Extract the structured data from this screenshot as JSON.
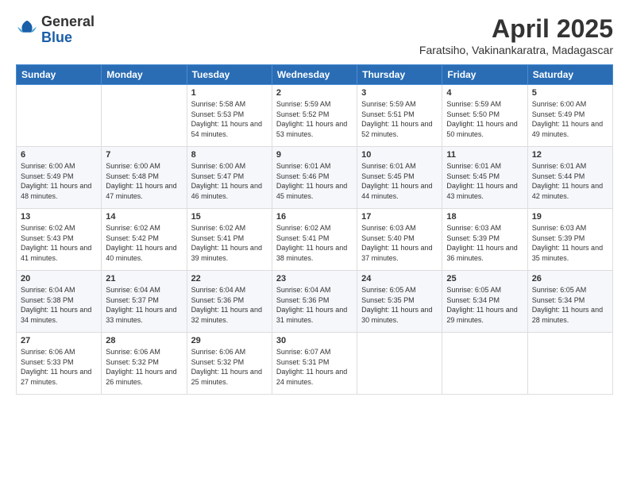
{
  "header": {
    "logo": {
      "general": "General",
      "blue": "Blue"
    },
    "title": "April 2025",
    "location": "Faratsiho, Vakinankaratra, Madagascar"
  },
  "calendar": {
    "days_of_week": [
      "Sunday",
      "Monday",
      "Tuesday",
      "Wednesday",
      "Thursday",
      "Friday",
      "Saturday"
    ],
    "weeks": [
      [
        {
          "day": "",
          "sunrise": "",
          "sunset": "",
          "daylight": "",
          "empty": true
        },
        {
          "day": "",
          "sunrise": "",
          "sunset": "",
          "daylight": "",
          "empty": true
        },
        {
          "day": "1",
          "sunrise": "Sunrise: 5:58 AM",
          "sunset": "Sunset: 5:53 PM",
          "daylight": "Daylight: 11 hours and 54 minutes."
        },
        {
          "day": "2",
          "sunrise": "Sunrise: 5:59 AM",
          "sunset": "Sunset: 5:52 PM",
          "daylight": "Daylight: 11 hours and 53 minutes."
        },
        {
          "day": "3",
          "sunrise": "Sunrise: 5:59 AM",
          "sunset": "Sunset: 5:51 PM",
          "daylight": "Daylight: 11 hours and 52 minutes."
        },
        {
          "day": "4",
          "sunrise": "Sunrise: 5:59 AM",
          "sunset": "Sunset: 5:50 PM",
          "daylight": "Daylight: 11 hours and 50 minutes."
        },
        {
          "day": "5",
          "sunrise": "Sunrise: 6:00 AM",
          "sunset": "Sunset: 5:49 PM",
          "daylight": "Daylight: 11 hours and 49 minutes."
        }
      ],
      [
        {
          "day": "6",
          "sunrise": "Sunrise: 6:00 AM",
          "sunset": "Sunset: 5:49 PM",
          "daylight": "Daylight: 11 hours and 48 minutes."
        },
        {
          "day": "7",
          "sunrise": "Sunrise: 6:00 AM",
          "sunset": "Sunset: 5:48 PM",
          "daylight": "Daylight: 11 hours and 47 minutes."
        },
        {
          "day": "8",
          "sunrise": "Sunrise: 6:00 AM",
          "sunset": "Sunset: 5:47 PM",
          "daylight": "Daylight: 11 hours and 46 minutes."
        },
        {
          "day": "9",
          "sunrise": "Sunrise: 6:01 AM",
          "sunset": "Sunset: 5:46 PM",
          "daylight": "Daylight: 11 hours and 45 minutes."
        },
        {
          "day": "10",
          "sunrise": "Sunrise: 6:01 AM",
          "sunset": "Sunset: 5:45 PM",
          "daylight": "Daylight: 11 hours and 44 minutes."
        },
        {
          "day": "11",
          "sunrise": "Sunrise: 6:01 AM",
          "sunset": "Sunset: 5:45 PM",
          "daylight": "Daylight: 11 hours and 43 minutes."
        },
        {
          "day": "12",
          "sunrise": "Sunrise: 6:01 AM",
          "sunset": "Sunset: 5:44 PM",
          "daylight": "Daylight: 11 hours and 42 minutes."
        }
      ],
      [
        {
          "day": "13",
          "sunrise": "Sunrise: 6:02 AM",
          "sunset": "Sunset: 5:43 PM",
          "daylight": "Daylight: 11 hours and 41 minutes."
        },
        {
          "day": "14",
          "sunrise": "Sunrise: 6:02 AM",
          "sunset": "Sunset: 5:42 PM",
          "daylight": "Daylight: 11 hours and 40 minutes."
        },
        {
          "day": "15",
          "sunrise": "Sunrise: 6:02 AM",
          "sunset": "Sunset: 5:41 PM",
          "daylight": "Daylight: 11 hours and 39 minutes."
        },
        {
          "day": "16",
          "sunrise": "Sunrise: 6:02 AM",
          "sunset": "Sunset: 5:41 PM",
          "daylight": "Daylight: 11 hours and 38 minutes."
        },
        {
          "day": "17",
          "sunrise": "Sunrise: 6:03 AM",
          "sunset": "Sunset: 5:40 PM",
          "daylight": "Daylight: 11 hours and 37 minutes."
        },
        {
          "day": "18",
          "sunrise": "Sunrise: 6:03 AM",
          "sunset": "Sunset: 5:39 PM",
          "daylight": "Daylight: 11 hours and 36 minutes."
        },
        {
          "day": "19",
          "sunrise": "Sunrise: 6:03 AM",
          "sunset": "Sunset: 5:39 PM",
          "daylight": "Daylight: 11 hours and 35 minutes."
        }
      ],
      [
        {
          "day": "20",
          "sunrise": "Sunrise: 6:04 AM",
          "sunset": "Sunset: 5:38 PM",
          "daylight": "Daylight: 11 hours and 34 minutes."
        },
        {
          "day": "21",
          "sunrise": "Sunrise: 6:04 AM",
          "sunset": "Sunset: 5:37 PM",
          "daylight": "Daylight: 11 hours and 33 minutes."
        },
        {
          "day": "22",
          "sunrise": "Sunrise: 6:04 AM",
          "sunset": "Sunset: 5:36 PM",
          "daylight": "Daylight: 11 hours and 32 minutes."
        },
        {
          "day": "23",
          "sunrise": "Sunrise: 6:04 AM",
          "sunset": "Sunset: 5:36 PM",
          "daylight": "Daylight: 11 hours and 31 minutes."
        },
        {
          "day": "24",
          "sunrise": "Sunrise: 6:05 AM",
          "sunset": "Sunset: 5:35 PM",
          "daylight": "Daylight: 11 hours and 30 minutes."
        },
        {
          "day": "25",
          "sunrise": "Sunrise: 6:05 AM",
          "sunset": "Sunset: 5:34 PM",
          "daylight": "Daylight: 11 hours and 29 minutes."
        },
        {
          "day": "26",
          "sunrise": "Sunrise: 6:05 AM",
          "sunset": "Sunset: 5:34 PM",
          "daylight": "Daylight: 11 hours and 28 minutes."
        }
      ],
      [
        {
          "day": "27",
          "sunrise": "Sunrise: 6:06 AM",
          "sunset": "Sunset: 5:33 PM",
          "daylight": "Daylight: 11 hours and 27 minutes."
        },
        {
          "day": "28",
          "sunrise": "Sunrise: 6:06 AM",
          "sunset": "Sunset: 5:32 PM",
          "daylight": "Daylight: 11 hours and 26 minutes."
        },
        {
          "day": "29",
          "sunrise": "Sunrise: 6:06 AM",
          "sunset": "Sunset: 5:32 PM",
          "daylight": "Daylight: 11 hours and 25 minutes."
        },
        {
          "day": "30",
          "sunrise": "Sunrise: 6:07 AM",
          "sunset": "Sunset: 5:31 PM",
          "daylight": "Daylight: 11 hours and 24 minutes."
        },
        {
          "day": "",
          "sunrise": "",
          "sunset": "",
          "daylight": "",
          "empty": true
        },
        {
          "day": "",
          "sunrise": "",
          "sunset": "",
          "daylight": "",
          "empty": true
        },
        {
          "day": "",
          "sunrise": "",
          "sunset": "",
          "daylight": "",
          "empty": true
        }
      ]
    ]
  }
}
